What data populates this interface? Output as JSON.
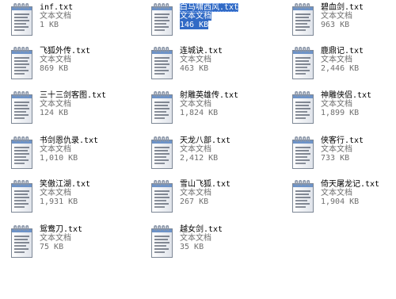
{
  "files": [
    {
      "name": "inf.txt",
      "type": "文本文档",
      "size": "1 KB",
      "selected": false
    },
    {
      "name": "白马啸西风.txt",
      "type": "文本文档",
      "size": "146 KB",
      "selected": true
    },
    {
      "name": "碧血剑.txt",
      "type": "文本文档",
      "size": "963 KB",
      "selected": false
    },
    {
      "name": "飞狐外传.txt",
      "type": "文本文档",
      "size": "869 KB",
      "selected": false
    },
    {
      "name": "连城诀.txt",
      "type": "文本文档",
      "size": "463 KB",
      "selected": false
    },
    {
      "name": "鹿鼎记.txt",
      "type": "文本文档",
      "size": "2,446 KB",
      "selected": false
    },
    {
      "name": "三十三剑客图.txt",
      "type": "文本文档",
      "size": "124 KB",
      "selected": false
    },
    {
      "name": "射雕英雄传.txt",
      "type": "文本文档",
      "size": "1,824 KB",
      "selected": false
    },
    {
      "name": "神雕侠侣.txt",
      "type": "文本文档",
      "size": "1,899 KB",
      "selected": false
    },
    {
      "name": "书剑恩仇录.txt",
      "type": "文本文档",
      "size": "1,010 KB",
      "selected": false
    },
    {
      "name": "天龙八部.txt",
      "type": "文本文档",
      "size": "2,412 KB",
      "selected": false
    },
    {
      "name": "侠客行.txt",
      "type": "文本文档",
      "size": "733 KB",
      "selected": false
    },
    {
      "name": "笑傲江湖.txt",
      "type": "文本文档",
      "size": "1,931 KB",
      "selected": false
    },
    {
      "name": "雪山飞狐.txt",
      "type": "文本文档",
      "size": "267 KB",
      "selected": false
    },
    {
      "name": "倚天屠龙记.txt",
      "type": "文本文档",
      "size": "1,904 KB",
      "selected": false
    },
    {
      "name": "鸳鸯刀.txt",
      "type": "文本文档",
      "size": "75 KB",
      "selected": false
    },
    {
      "name": "越女剑.txt",
      "type": "文本文档",
      "size": "35 KB",
      "selected": false
    }
  ],
  "icon": "notepad-text-file-icon",
  "colors": {
    "selection": "#316ac5",
    "secondary_text": "#6f6f6f"
  }
}
